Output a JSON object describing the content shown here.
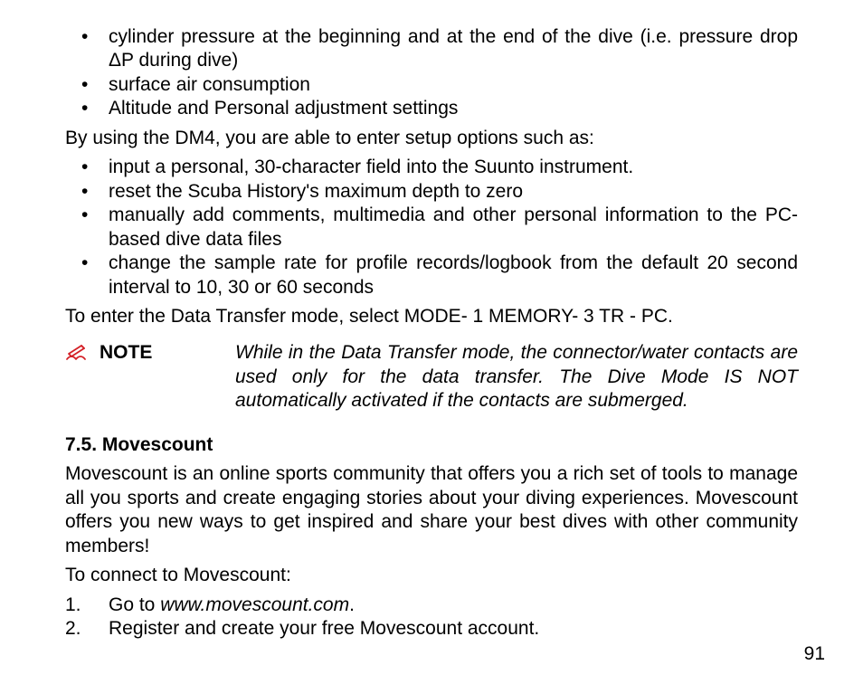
{
  "bulletsA": [
    "cylinder pressure at the beginning and at the end of the dive (i.e. pressure drop ΔP during dive)",
    "surface air consumption",
    "Altitude and Personal adjustment settings"
  ],
  "intro1": "By using the DM4, you are able to enter setup options such as:",
  "bulletsB": [
    "input a personal, 30-character field into the Suunto instrument.",
    "reset the Scuba History's maximum depth to zero",
    "manually add comments, multimedia and other personal information to the PC-based dive data files",
    "change the sample rate for profile records/logbook from the default 20 second interval to 10, 30 or 60 seconds"
  ],
  "intro2": "To enter the Data Transfer mode, select MODE- 1 MEMORY- 3 TR - PC.",
  "note": {
    "icon_glyph": "✍",
    "label": "NOTE",
    "text": "While in the Data Transfer mode, the connector/water contacts are used only for the data transfer. The Dive Mode IS NOT automatically activated if the contacts are submerged."
  },
  "section": {
    "heading": "7.5. Movescount",
    "body": "Movescount is an online sports community that offers you a rich set of tools to manage all you sports and create engaging stories about your diving experiences. Movescount offers you new ways to get inspired and share your best dives with other community members!",
    "lead": "To connect to Movescount:",
    "steps": [
      {
        "n": "1.",
        "text_pre": "Go to ",
        "text_italic": "www.movescount.com",
        "text_post": "."
      },
      {
        "n": "2.",
        "text_pre": "Register and create your free Movescount account.",
        "text_italic": "",
        "text_post": ""
      }
    ]
  },
  "page_number": "91"
}
